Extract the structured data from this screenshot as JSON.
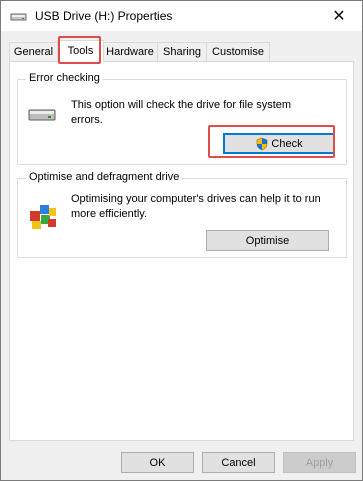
{
  "window": {
    "title": "USB Drive (H:) Properties",
    "close_glyph": "✕",
    "title_icon": "usb-drive-icon"
  },
  "tabs": [
    {
      "label": "General",
      "active": false
    },
    {
      "label": "Tools",
      "active": true
    },
    {
      "label": "Hardware",
      "active": false
    },
    {
      "label": "Sharing",
      "active": false
    },
    {
      "label": "Customise",
      "active": false
    }
  ],
  "error_checking": {
    "title": "Error checking",
    "description": "This option will check the drive for file system errors.",
    "button_label": "Check",
    "icon": "drive-icon",
    "button_icon": "uac-shield-icon"
  },
  "defrag": {
    "title": "Optimise and defragment drive",
    "description": "Optimising your computer's drives can help it to run more efficiently.",
    "button_label": "Optimise",
    "icon": "defrag-icon"
  },
  "footer": {
    "ok_label": "OK",
    "cancel_label": "Cancel",
    "apply_label": "Apply"
  },
  "colors": {
    "highlight": "#e04c4c",
    "focus": "#0078d7"
  }
}
